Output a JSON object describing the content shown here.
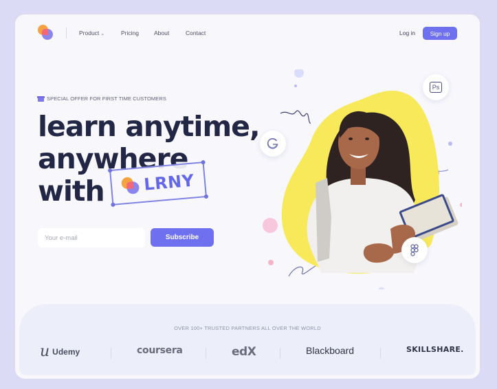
{
  "nav": {
    "links": [
      "Product",
      "Pricing",
      "About",
      "Contact"
    ],
    "product_chevron": "⌄",
    "login_label": "Log in",
    "signup_label": "Sign up"
  },
  "hero": {
    "offer_text": "SPECIAL OFFER FOR FIRST TIME CUSTOMERS",
    "headline_lines": [
      "learn anytime,",
      "anywhere",
      "with"
    ],
    "brand_name": "LRNY",
    "email_placeholder": "Your e-mail",
    "subscribe_label": "Subscribe"
  },
  "floating_icons": [
    "google-icon",
    "photoshop-icon",
    "figma-icon"
  ],
  "photoshop_label": "Ps",
  "partners": {
    "title": "OVER 100+ TRUSTED PARTNERS ALL OVER THE WORLD",
    "logos": [
      "Udemy",
      "coursera",
      "edX",
      "Blackboard",
      "SKILLSHARE."
    ]
  },
  "colors": {
    "accent": "#6f70ef",
    "headline": "#232746",
    "blob": "#f7e95a",
    "background": "#dcdbf5"
  }
}
